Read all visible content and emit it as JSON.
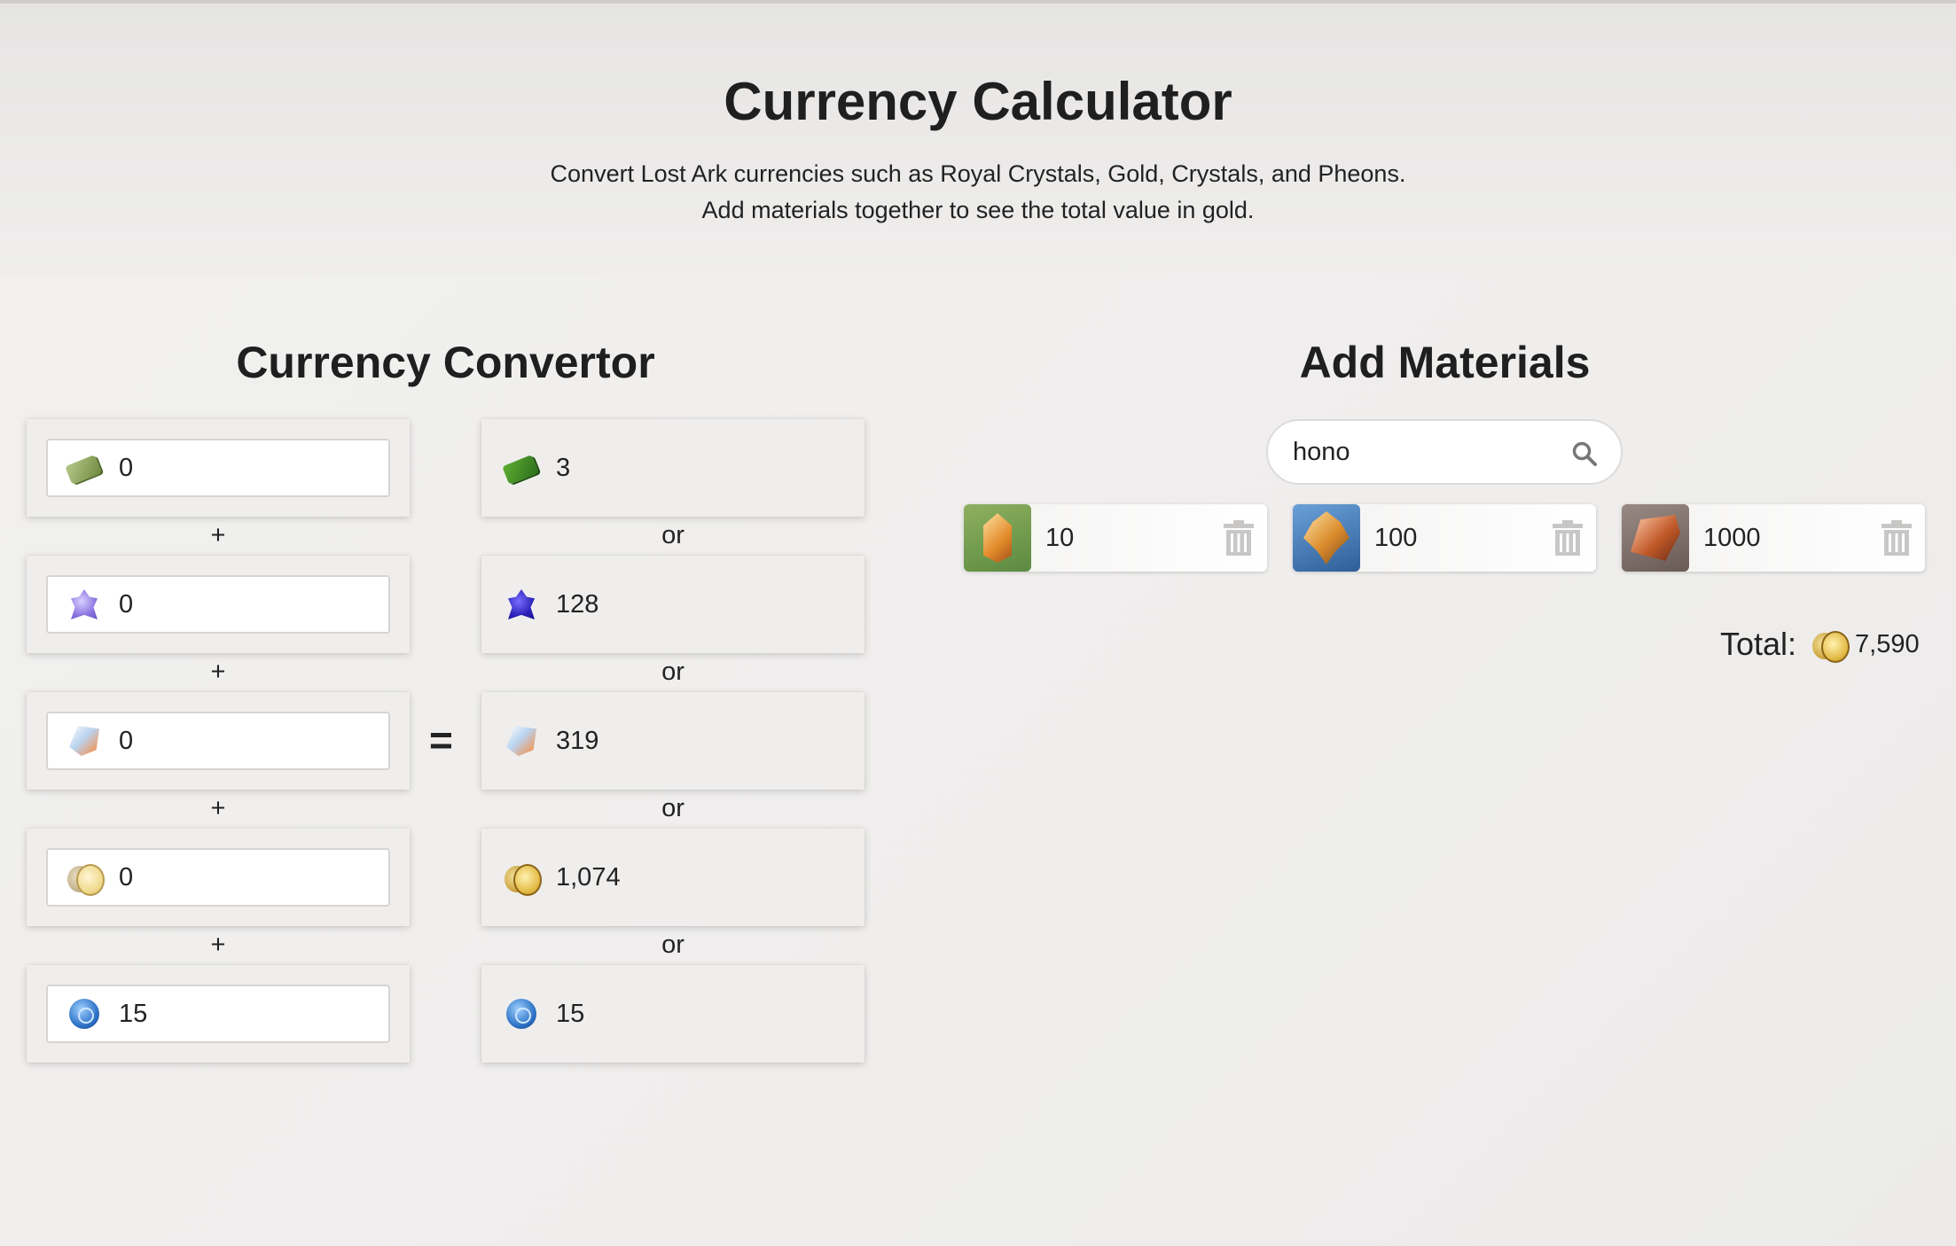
{
  "header": {
    "title": "Currency Calculator",
    "subtitle_line1": "Convert Lost Ark currencies such as Royal Crystals, Gold, Crystals, and Pheons.",
    "subtitle_line2": "Add materials together to see the total value in gold."
  },
  "converter": {
    "title": "Currency Convertor",
    "inputs": [
      {
        "icon": "banknote-icon",
        "value": "0"
      },
      {
        "icon": "royal-crystal-icon",
        "value": "0"
      },
      {
        "icon": "crystal-icon",
        "value": "0"
      },
      {
        "icon": "gold-icon",
        "value": "0"
      },
      {
        "icon": "pheon-icon",
        "value": "15"
      }
    ],
    "outputs": [
      {
        "icon": "banknote-icon",
        "value": "3"
      },
      {
        "icon": "royal-crystal-icon",
        "value": "128"
      },
      {
        "icon": "crystal-icon",
        "value": "319"
      },
      {
        "icon": "gold-icon",
        "value": "1,074"
      },
      {
        "icon": "pheon-icon",
        "value": "15"
      }
    ],
    "plus_label": "+",
    "or_label": "or",
    "equals_label": "="
  },
  "materials": {
    "title": "Add Materials",
    "search": {
      "value": "hono",
      "placeholder": ""
    },
    "items": [
      {
        "icon": "honor-leapstone-icon",
        "value": "10"
      },
      {
        "icon": "great-honor-leapstone-icon",
        "value": "100"
      },
      {
        "icon": "honor-shard-icon",
        "value": "1000"
      }
    ],
    "total_label": "Total:",
    "total_value": "7,590"
  }
}
